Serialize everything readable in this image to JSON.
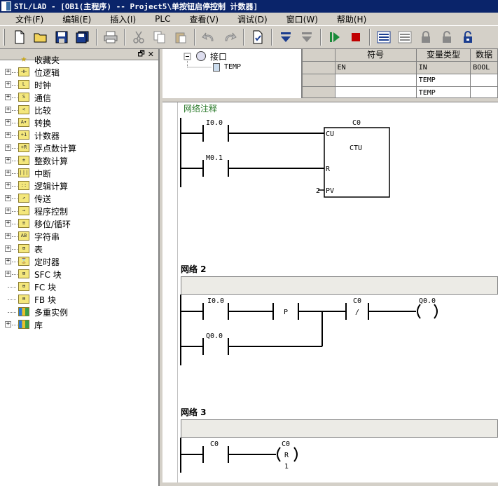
{
  "window": {
    "title": "STL/LAD - [OB1(主程序) -- Project5\\单按钮启停控制 计数器]"
  },
  "menu": [
    {
      "label": "文件(F)"
    },
    {
      "label": "编辑(E)"
    },
    {
      "label": "插入(I)"
    },
    {
      "label": "PLC"
    },
    {
      "label": "查看(V)"
    },
    {
      "label": "调试(D)"
    },
    {
      "label": "窗口(W)"
    },
    {
      "label": "帮助(H)"
    }
  ],
  "toolbar": {
    "icons": [
      "new-icon",
      "open-icon",
      "save-icon",
      "save-all-icon",
      "print-icon",
      "cut-icon",
      "copy-icon",
      "paste-icon",
      "undo-icon",
      "redo-icon",
      "compile-icon",
      "download-icon",
      "upload-icon",
      "run-icon",
      "stop-icon",
      "program-status-icon",
      "table-status-icon",
      "lock-icon",
      "unlock-icon",
      "unlock-all-icon"
    ]
  },
  "panel": {
    "controls": {
      "float": "🗗",
      "close": "✕"
    },
    "items": [
      {
        "label": "收藏夹",
        "icon": "star-icon",
        "glyph": "★"
      },
      {
        "label": "位逻辑",
        "icon": "bit-logic-icon",
        "glyph": "⊣⊢"
      },
      {
        "label": "时钟",
        "icon": "clock-icon",
        "glyph": "L"
      },
      {
        "label": "通信",
        "icon": "communication-icon",
        "glyph": "S"
      },
      {
        "label": "比较",
        "icon": "compare-icon",
        "glyph": "<"
      },
      {
        "label": "转换",
        "icon": "convert-icon",
        "glyph": "A▾"
      },
      {
        "label": "计数器",
        "icon": "counter-icon",
        "glyph": "+1"
      },
      {
        "label": "浮点数计算",
        "icon": "float-math-icon",
        "glyph": "+R"
      },
      {
        "label": "整数计算",
        "icon": "integer-math-icon",
        "glyph": "±"
      },
      {
        "label": "中断",
        "icon": "interrupt-icon",
        "glyph": "|||"
      },
      {
        "label": "逻辑计算",
        "icon": "logic-ops-icon",
        "glyph": "::"
      },
      {
        "label": "传送",
        "icon": "move-icon",
        "glyph": "↗"
      },
      {
        "label": "程序控制",
        "icon": "program-control-icon",
        "glyph": "→"
      },
      {
        "label": "移位/循环",
        "icon": "shift-rotate-icon",
        "glyph": "≡"
      },
      {
        "label": "字符串",
        "icon": "string-icon",
        "glyph": "AB"
      },
      {
        "label": "表",
        "icon": "table-icon",
        "glyph": "⊞"
      },
      {
        "label": "定时器",
        "icon": "timer-icon",
        "glyph": "⌛"
      },
      {
        "label": "SFC 块",
        "icon": "sfc-block-icon",
        "glyph": "⊞"
      },
      {
        "label": "FC 块",
        "icon": "fc-block-icon",
        "glyph": "⊞"
      },
      {
        "label": "FB 块",
        "icon": "fb-block-icon",
        "glyph": "⊞"
      },
      {
        "label": "多重实例",
        "icon": "multi-instance-icon",
        "glyph": "▥"
      },
      {
        "label": "库",
        "icon": "library-icon",
        "glyph": "▥"
      }
    ]
  },
  "interface": {
    "root": "接口",
    "child": "TEMP",
    "columns": [
      "符号",
      "变量类型",
      "数据"
    ],
    "rows": [
      [
        "EN",
        "IN",
        "BOOL"
      ],
      [
        "",
        "TEMP",
        ""
      ],
      [
        "",
        "TEMP",
        ""
      ]
    ]
  },
  "networks": [
    {
      "title": "",
      "comment": "网络注释",
      "contacts": [
        {
          "label": "I0.0",
          "type": "NO"
        },
        {
          "label": "M0.1",
          "type": "NO"
        }
      ],
      "box": {
        "name": "C0",
        "type": "CTU",
        "pins": [
          "CU",
          "R",
          "PV"
        ],
        "pv_value": "2"
      }
    },
    {
      "title": "网络 2",
      "contacts": [
        {
          "label": "I0.0",
          "type": "NO"
        },
        {
          "label": "P",
          "type": "P"
        },
        {
          "label": "C0",
          "type": "NC",
          "mark": "/"
        },
        {
          "label": "Q0.0",
          "type": "NO"
        }
      ],
      "coil": {
        "label": "Q0.0",
        "type": "normal"
      }
    },
    {
      "title": "网络 3",
      "contacts": [
        {
          "label": "C0",
          "type": "NO"
        }
      ],
      "coil": {
        "label": "C0",
        "type": "reset",
        "mark": "R",
        "count": "1"
      }
    }
  ]
}
